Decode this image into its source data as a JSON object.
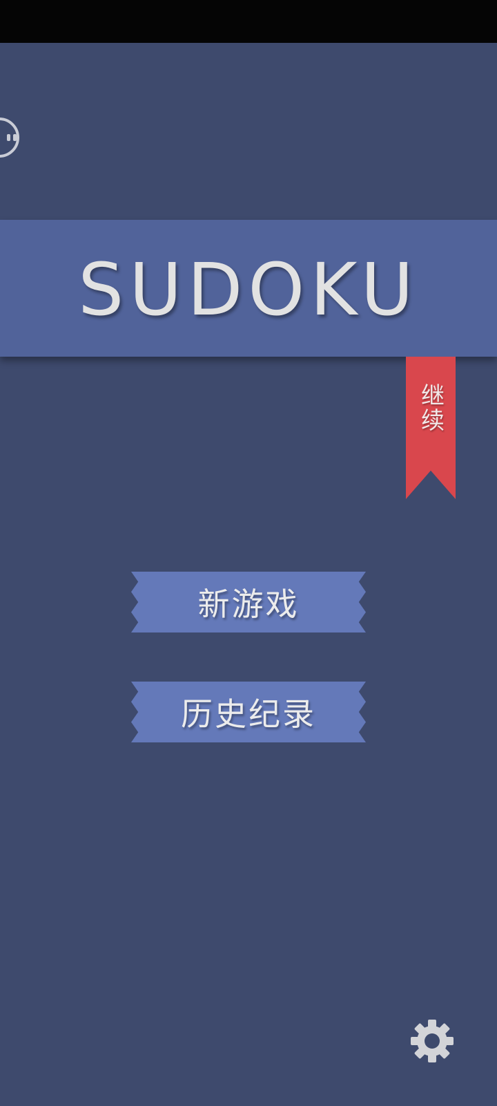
{
  "app": {
    "title": "SUDOKU",
    "continue_label": "继续",
    "menu": {
      "new_game_label": "新游戏",
      "history_label": "历史纪录"
    }
  },
  "icons": {
    "profile": "profile-icon",
    "settings": "gear-icon"
  },
  "colors": {
    "background": "#3e4a6d",
    "title_banner": "#51639a",
    "continue_ribbon": "#d9474d",
    "menu_button": "#6479b9",
    "text": "#e2e2e2"
  }
}
